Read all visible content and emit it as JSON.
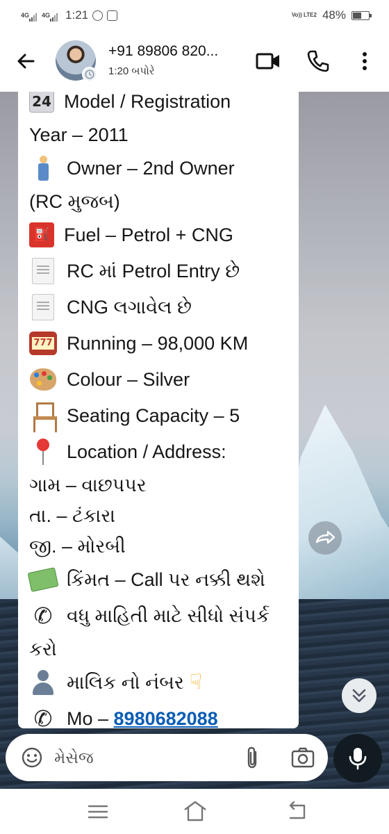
{
  "status_bar": {
    "network_1": "4G",
    "network_2": "4G",
    "time": "1:21",
    "carrier_label": "Vo)) LTE2",
    "battery_percent_text": "48%",
    "battery_level": 0.48
  },
  "header": {
    "contact_name": "+91 89806 820...",
    "contact_status": "1:20 બપોરે"
  },
  "message": {
    "line_01": "Model / Registration",
    "line_02": "Year – 2011",
    "line_03": "Owner – 2nd Owner",
    "line_04": "(RC મુજબ)",
    "line_05": "Fuel – Petrol + CNG",
    "line_06": "RC માં Petrol Entry છે",
    "line_07": "CNG લગાવેલ છે",
    "line_08": "Running – 98,000 KM",
    "line_09": "Colour – Silver",
    "line_10": "Seating Capacity – 5",
    "line_11": "Location / Address:",
    "line_12": "ગામ – વાછપપર",
    "line_13": "તા. – ટંકારા",
    "line_14": "જી. – મોરબી",
    "line_15": "કિંમત – Call પર નક્કી થશે",
    "line_16": "વધુ માહિતી માટે સીધો સંપર્ક",
    "line_17": "કરો",
    "line_18": "માલિક નો નંબર",
    "line_19_prefix": "Mo – ",
    "phone_link": "8980682088",
    "emoji_24": "24"
  },
  "composer": {
    "placeholder": "મેસેજ"
  },
  "icons": {
    "back": "back-arrow-icon",
    "video": "video-call-icon",
    "call": "phone-call-icon",
    "more": "more-vert-icon",
    "forward": "forward-icon",
    "scroll": "double-chevron-down-icon",
    "emoji": "emoji-icon",
    "attach": "paperclip-icon",
    "camera": "camera-icon",
    "mic": "microphone-icon"
  }
}
